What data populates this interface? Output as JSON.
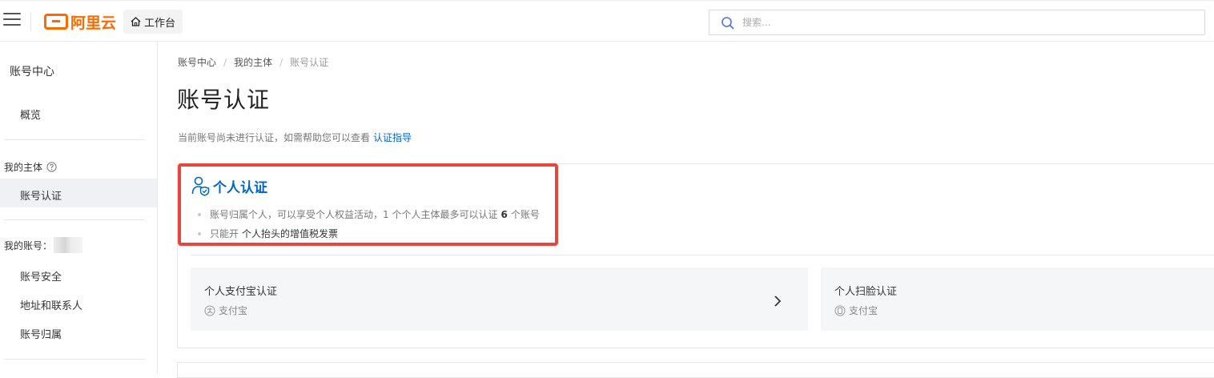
{
  "header": {
    "logo_text": "阿里云",
    "workbench_label": "工作台",
    "search_placeholder": "搜索...",
    "brand_color": "#ff6a00"
  },
  "sidebar": {
    "title": "账号中心",
    "overview": "概览",
    "my_entity_group": "我的主体",
    "account_verification": "账号认证",
    "my_account_group": "我的账号：",
    "account_security": "账号安全",
    "address_contacts": "地址和联系人",
    "account_ownership": "账号归属"
  },
  "breadcrumb": [
    "账号中心",
    "我的主体",
    "账号认证"
  ],
  "page": {
    "title": "账号认证",
    "notice": "当前账号尚未进行认证，如需帮助您可以查看",
    "notice_link": "认证指导"
  },
  "personal": {
    "title": "个人认证",
    "bullet1_prefix": "账号归属个人，可以享受个人权益活动，1 个个人主体最多可以认证",
    "bullet1_count": "6",
    "bullet1_suffix": "个账号",
    "bullet2_prefix": "只能开",
    "bullet2_strong": "个人抬头的增值税发票",
    "accent_color": "#0064c8",
    "highlight_color": "#e8453c"
  },
  "options": [
    {
      "title": "个人支付宝认证",
      "sub": "支付宝",
      "icon": "alipay-icon"
    },
    {
      "title": "个人扫脸认证",
      "sub": "支付宝",
      "icon": "face-scan-icon"
    }
  ]
}
